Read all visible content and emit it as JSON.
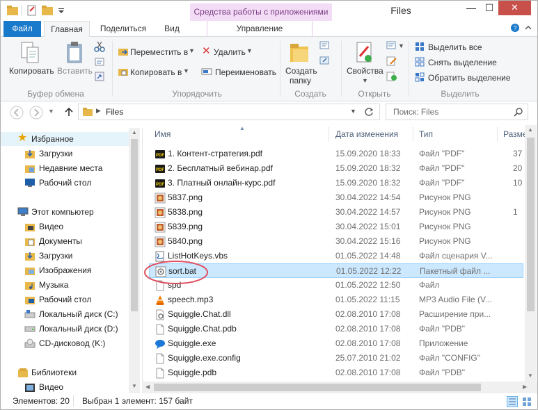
{
  "title": "Files",
  "context_tab_title": "Средства работы с приложениями",
  "window_buttons": {
    "minimize": "—",
    "maximize": "☐",
    "close": "✕"
  },
  "tabs": {
    "file": "Файл",
    "home": "Главная",
    "share": "Поделиться",
    "view": "Вид",
    "manage": "Управление"
  },
  "ribbon": {
    "clipboard": {
      "copy": "Копировать",
      "paste": "Вставить",
      "group": "Буфер обмена"
    },
    "organize": {
      "move": "Переместить в",
      "copy_to": "Копировать в",
      "delete": "Удалить",
      "rename": "Переименовать",
      "group": "Упорядочить"
    },
    "create": {
      "new_folder_1": "Создать",
      "new_folder_2": "папку",
      "group": "Создать"
    },
    "open": {
      "properties": "Свойства",
      "group": "Открыть"
    },
    "select": {
      "select_all": "Выделить все",
      "select_none": "Снять выделение",
      "invert": "Обратить выделение",
      "group": "Выделить"
    }
  },
  "address": {
    "path": "Files",
    "search_placeholder": "Поиск: Files"
  },
  "nav": {
    "favorites": "Избранное",
    "downloads": "Загрузки",
    "recent": "Недавние места",
    "desktop": "Рабочий стол",
    "computer": "Этот компьютер",
    "video": "Видео",
    "documents": "Документы",
    "downloads2": "Загрузки",
    "pictures": "Изображения",
    "music": "Музыка",
    "desktop2": "Рабочий стол",
    "disk_c": "Локальный диск (C:)",
    "disk_d": "Локальный диск (D:)",
    "cd": "CD-дисковод (K:)",
    "libraries": "Библиотеки",
    "lib_video": "Видео"
  },
  "columns": {
    "name": "Имя",
    "date": "Дата изменения",
    "type": "Тип",
    "size": "Разме"
  },
  "files": [
    {
      "name": "1. Контент-стратегия.pdf",
      "date": "15.09.2020 18:33",
      "type": "Файл \"PDF\"",
      "size": "37",
      "icon": "pdf-icon"
    },
    {
      "name": "2. Бесплатный вебинар.pdf",
      "date": "15.09.2020 18:32",
      "type": "Файл \"PDF\"",
      "size": "20",
      "icon": "pdf-icon"
    },
    {
      "name": "3. Платный онлайн-курс.pdf",
      "date": "15.09.2020 18:32",
      "type": "Файл \"PDF\"",
      "size": "10",
      "icon": "pdf-icon"
    },
    {
      "name": "5837.png",
      "date": "30.04.2022 14:54",
      "type": "Рисунок PNG",
      "size": "",
      "icon": "png-icon"
    },
    {
      "name": "5838.png",
      "date": "30.04.2022 14:57",
      "type": "Рисунок PNG",
      "size": "1",
      "icon": "png-icon"
    },
    {
      "name": "5839.png",
      "date": "30.04.2022 15:01",
      "type": "Рисунок PNG",
      "size": "",
      "icon": "png-icon"
    },
    {
      "name": "5840.png",
      "date": "30.04.2022 15:16",
      "type": "Рисунок PNG",
      "size": "",
      "icon": "png-icon"
    },
    {
      "name": "ListHotKeys.vbs",
      "date": "01.05.2022 14:48",
      "type": "Файл сценария V...",
      "size": "",
      "icon": "script-icon"
    },
    {
      "name": "sort.bat",
      "date": "01.05.2022 12:22",
      "type": "Пакетный файл ...",
      "size": "",
      "icon": "bat-icon"
    },
    {
      "name": "spd",
      "date": "01.05.2022 12:50",
      "type": "Файл",
      "size": "",
      "icon": "blank-file-icon"
    },
    {
      "name": "speech.mp3",
      "date": "01.05.2022 11:15",
      "type": "MP3 Audio File (V...",
      "size": "",
      "icon": "vlc-icon"
    },
    {
      "name": "Squiggle.Chat.dll",
      "date": "02.08.2010 17:08",
      "type": "Расширение при...",
      "size": "",
      "icon": "dll-icon"
    },
    {
      "name": "Squiggle.Chat.pdb",
      "date": "02.08.2010 17:08",
      "type": "Файл \"PDB\"",
      "size": "",
      "icon": "blank-file-icon"
    },
    {
      "name": "Squiggle.exe",
      "date": "02.08.2010 17:08",
      "type": "Приложение",
      "size": "",
      "icon": "chat-icon"
    },
    {
      "name": "Squiggle.exe.config",
      "date": "25.07.2010 21:02",
      "type": "Файл \"CONFIG\"",
      "size": "",
      "icon": "blank-file-icon"
    },
    {
      "name": "Squiggle.pdb",
      "date": "02.08.2010 17:08",
      "type": "Файл \"PDB\"",
      "size": "",
      "icon": "blank-file-icon"
    }
  ],
  "status": {
    "count": "Элементов: 20",
    "selected": "Выбран 1 элемент: 157 байт"
  },
  "colors": {
    "accent": "#1979ca",
    "selection": "#cce8ff",
    "highlight_ellipse": "#e05060",
    "context_tab": "#f3dcf5"
  }
}
